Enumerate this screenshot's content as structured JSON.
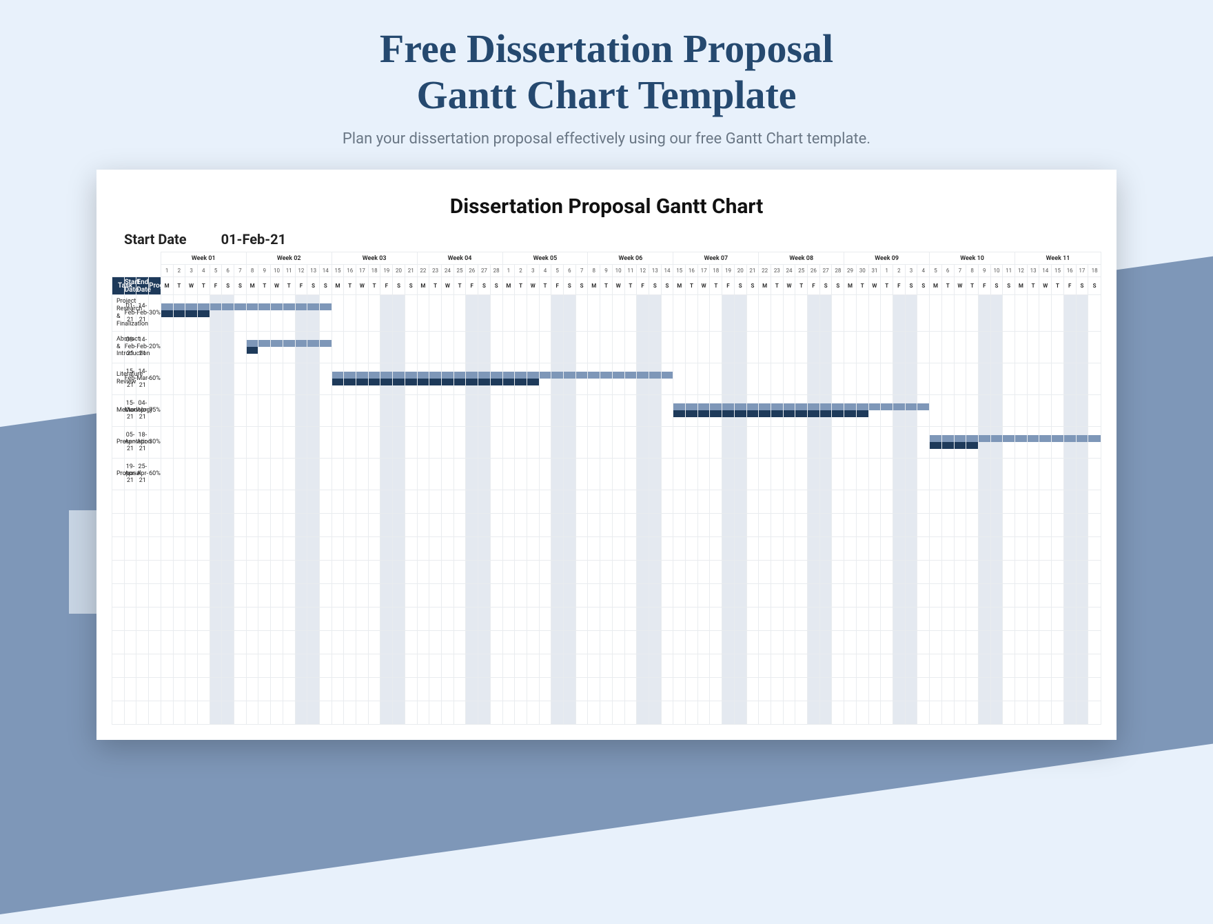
{
  "page": {
    "title_line1": "Free Dissertation Proposal",
    "title_line2": "Gantt Chart Template",
    "subtitle": "Plan your dissertation proposal effectively using our free Gantt Chart template."
  },
  "chart_title": "Dissertation Proposal Gantt Chart",
  "start_date_label": "Start Date",
  "start_date_value": "01-Feb-21",
  "headers": {
    "task": "Task",
    "start": "Start Date",
    "end": "End Date",
    "progress": "Progress"
  },
  "weeks": [
    "Week 01",
    "Week 02",
    "Week 03",
    "Week 04",
    "Week 05",
    "Week 06",
    "Week 07",
    "Week 08",
    "Week 09",
    "Week 10",
    "Week 11"
  ],
  "day_numbers": [
    "1",
    "2",
    "3",
    "4",
    "5",
    "6",
    "7",
    "8",
    "9",
    "10",
    "11",
    "12",
    "13",
    "14",
    "15",
    "16",
    "17",
    "18",
    "19",
    "20",
    "21",
    "22",
    "23",
    "24",
    "25",
    "26",
    "27",
    "28",
    "1",
    "2",
    "3",
    "4",
    "5",
    "6",
    "7",
    "8",
    "9",
    "10",
    "11",
    "12",
    "13",
    "14",
    "15",
    "16",
    "17",
    "18",
    "19",
    "20",
    "21",
    "22",
    "23",
    "24",
    "25",
    "26",
    "27",
    "28",
    "29",
    "30",
    "31",
    "1",
    "2",
    "3",
    "4",
    "5",
    "6",
    "7",
    "8",
    "9",
    "10",
    "11",
    "12",
    "13",
    "14",
    "15",
    "16",
    "17",
    "18"
  ],
  "dow": [
    "M",
    "T",
    "W",
    "T",
    "F",
    "S",
    "S",
    "M",
    "T",
    "W",
    "T",
    "F",
    "S",
    "S",
    "M",
    "T",
    "W",
    "T",
    "F",
    "S",
    "S",
    "M",
    "T",
    "W",
    "T",
    "F",
    "S",
    "S",
    "M",
    "T",
    "W",
    "T",
    "F",
    "S",
    "S",
    "M",
    "T",
    "W",
    "T",
    "F",
    "S",
    "S",
    "M",
    "T",
    "W",
    "T",
    "F",
    "S",
    "S",
    "M",
    "T",
    "W",
    "T",
    "F",
    "S",
    "S",
    "M",
    "T",
    "W",
    "T",
    "F",
    "S",
    "S",
    "M",
    "T",
    "W",
    "T",
    "F",
    "S",
    "S",
    "M",
    "T",
    "W",
    "T",
    "F",
    "S",
    "S"
  ],
  "tasks": [
    {
      "name": "Project Research & Finalization",
      "start": "01-Feb-21",
      "end": "14-Feb-21",
      "progress": "30%",
      "start_day": 0,
      "end_day": 13,
      "prog_pct": 0.3
    },
    {
      "name": "Abstract & Introduction",
      "start": "08-Feb-21",
      "end": "14-Feb-21",
      "progress": "20%",
      "start_day": 7,
      "end_day": 13,
      "prog_pct": 0.2
    },
    {
      "name": "Literature Review",
      "start": "15-Feb-21",
      "end": "14-Mar-21",
      "progress": "60%",
      "start_day": 14,
      "end_day": 41,
      "prog_pct": 0.6
    },
    {
      "name": "Methodology",
      "start": "15-Mar-21",
      "end": "04-Apr-21",
      "progress": "75%",
      "start_day": 42,
      "end_day": 62,
      "prog_pct": 0.75
    },
    {
      "name": "Presentation",
      "start": "05-Apr-21",
      "end": "18-Apr-21",
      "progress": "30%",
      "start_day": 63,
      "end_day": 76,
      "prog_pct": 0.3
    },
    {
      "name": "Proposal",
      "start": "19-Apr-21",
      "end": "25-Apr-21",
      "progress": "60%",
      "start_day": 77,
      "end_day": 83,
      "prog_pct": 0.6
    }
  ],
  "empty_rows": 10,
  "chart_data": {
    "type": "gantt",
    "title": "Dissertation Proposal Gantt Chart",
    "start_date": "2021-02-01",
    "x_unit": "days",
    "x_range": [
      0,
      77
    ],
    "series": [
      {
        "name": "Project Research & Finalization",
        "start": "2021-02-01",
        "end": "2021-02-14",
        "progress": 30
      },
      {
        "name": "Abstract & Introduction",
        "start": "2021-02-08",
        "end": "2021-02-14",
        "progress": 20
      },
      {
        "name": "Literature Review",
        "start": "2021-02-15",
        "end": "2021-03-14",
        "progress": 60
      },
      {
        "name": "Methodology",
        "start": "2021-03-15",
        "end": "2021-04-04",
        "progress": 75
      },
      {
        "name": "Presentation",
        "start": "2021-04-05",
        "end": "2021-04-18",
        "progress": 30
      },
      {
        "name": "Proposal",
        "start": "2021-04-19",
        "end": "2021-04-25",
        "progress": 60
      }
    ],
    "colors": {
      "plan": "#7e97b8",
      "progress": "#1e3a5a"
    }
  }
}
